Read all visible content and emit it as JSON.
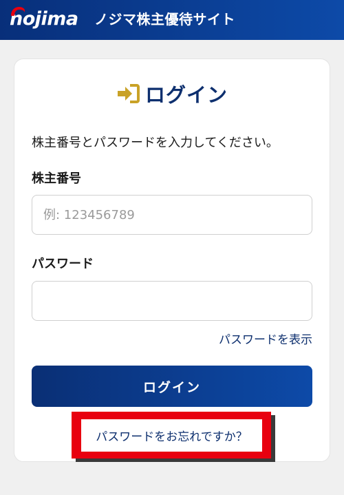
{
  "header": {
    "logo_text": "nojima",
    "title": "ノジマ株主優待サイト"
  },
  "login": {
    "heading": "ログイン",
    "instruction": "株主番号とパスワードを入力してください。",
    "shareholder_label": "株主番号",
    "shareholder_placeholder": "例: 123456789",
    "shareholder_value": "",
    "password_label": "パスワード",
    "password_value": "",
    "show_password": "パスワードを表示",
    "login_button": "ログイン",
    "forgot_password": "パスワードをお忘れですか？"
  },
  "colors": {
    "brand_blue": "#0a3a8c",
    "heading_navy": "#0d2f6e",
    "icon_gold": "#c9a227",
    "highlight_red": "#e8000f"
  },
  "icons": {
    "logo_arc": "red-arc-icon",
    "login": "sign-in-icon"
  }
}
